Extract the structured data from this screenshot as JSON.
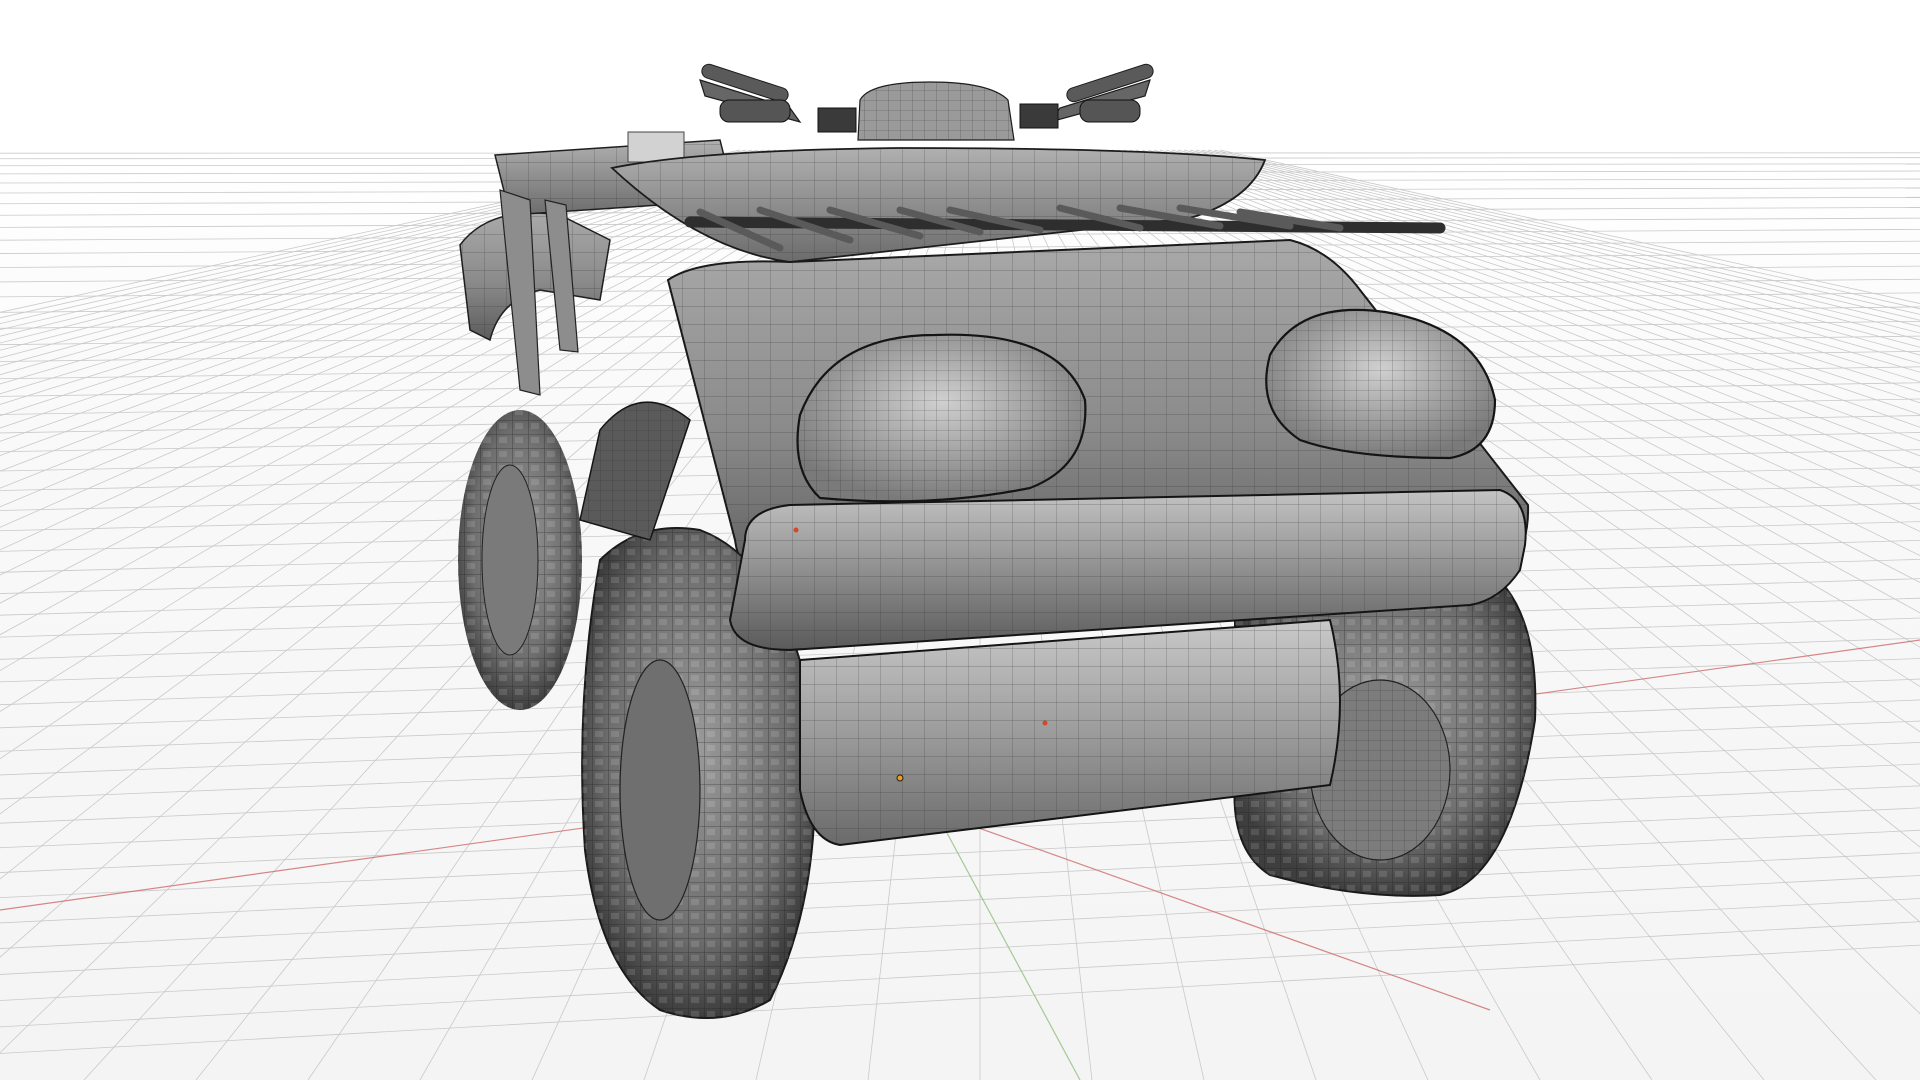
{
  "viewport": {
    "mode": "wireframe-shaded",
    "subject": "atv-quad-mesh",
    "grid": "on",
    "colors": {
      "background": "#ffffff",
      "grid": "#c9c9c9",
      "x_axis": "#cf6a6a",
      "y_axis": "#8fbf7a",
      "mesh_shade_light": "#b5b5b5",
      "mesh_shade_dark": "#555555",
      "wire": "#222222",
      "selected_vertex": "#e8a020"
    }
  }
}
